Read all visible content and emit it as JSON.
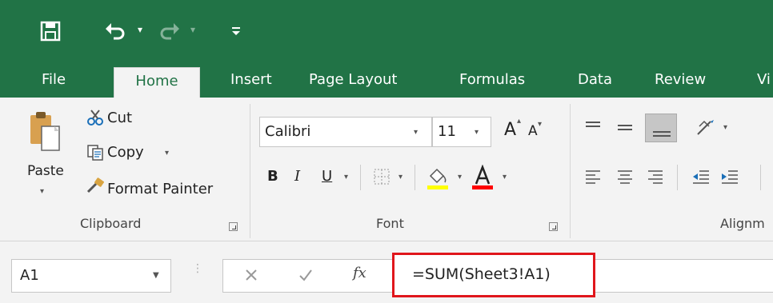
{
  "qat": {
    "save_icon": "save-icon",
    "undo_icon": "undo-icon",
    "redo_icon": "redo-icon",
    "customize_icon": "customize-qat-icon"
  },
  "tabs": [
    {
      "label": "File"
    },
    {
      "label": "Home"
    },
    {
      "label": "Insert"
    },
    {
      "label": "Page Layout"
    },
    {
      "label": "Formulas"
    },
    {
      "label": "Data"
    },
    {
      "label": "Review"
    },
    {
      "label": "Vi"
    }
  ],
  "clipboard": {
    "paste_label": "Paste",
    "cut_label": "Cut",
    "copy_label": "Copy",
    "format_painter_label": "Format Painter",
    "group_label": "Clipboard"
  },
  "font": {
    "font_name": "Calibri",
    "font_size": "11",
    "bold": "B",
    "italic": "I",
    "underline": "U",
    "font_color_letter": "A",
    "grow_letter": "A",
    "shrink_letter": "A",
    "group_label": "Font",
    "highlight_color": "#ffff00",
    "font_color": "#ff0000"
  },
  "alignment": {
    "group_label": "Alignm"
  },
  "formula_bar": {
    "name_box": "A1",
    "fx_label": "fx",
    "formula": "=SUM(Sheet3!A1)",
    "highlight_color": "#e0161c"
  },
  "colors": {
    "brand": "#217346",
    "ribbon_bg": "#f3f3f3"
  }
}
